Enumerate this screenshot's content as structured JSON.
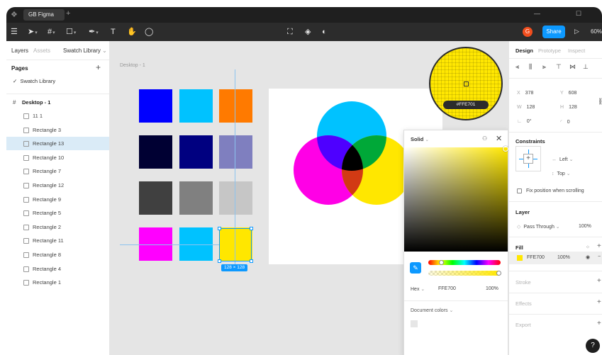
{
  "titlebar": {
    "tab": "GB Figma",
    "new_tab": "+",
    "minimize": "—",
    "maximize": "☐"
  },
  "toolbar": {
    "avatar": "G",
    "share": "Share",
    "zoom": "60%"
  },
  "left_panel": {
    "tabs": [
      "Layers",
      "Assets",
      "Swatch Library"
    ],
    "pages_heading": "Pages",
    "pages": [
      "Swatch Library"
    ],
    "frame": "Desktop - 1",
    "layers": [
      "11 1",
      "Rectangle 3",
      "Rectangle 13",
      "Rectangle 10",
      "Rectangle 7",
      "Rectangle 12",
      "Rectangle 9",
      "Rectangle 5",
      "Rectangle 2",
      "Rectangle 11",
      "Rectangle 8",
      "Rectangle 4",
      "Rectangle 1"
    ],
    "selected_layer": "Rectangle 13"
  },
  "canvas": {
    "frame_label": "Desktop - 1",
    "selection_size": "128 × 128",
    "swatches": [
      "#0000ff",
      "#00c2ff",
      "#ff7a00",
      "#000033",
      "#000080",
      "#7f7fbf",
      "#404040",
      "#808080",
      "#c6c6c6",
      "#ff00ff",
      "#00c2ff",
      "#ffe700"
    ],
    "magnifier_hex": "#FFE701"
  },
  "picker": {
    "mode": "Solid",
    "hex_label": "Hex",
    "hex_value": "FFE700",
    "opacity": "100%",
    "document_colors": "Document colors"
  },
  "right_panel": {
    "tabs": [
      "Design",
      "Prototype",
      "Inspect"
    ],
    "x": "378",
    "y": "608",
    "w": "128",
    "h": "128",
    "rotation": "0°",
    "radius": "0",
    "constraints": "Constraints",
    "constraint_h": "Left",
    "constraint_v": "Top",
    "fix_position": "Fix position when scrolling",
    "layer": "Layer",
    "blend": "Pass Through",
    "layer_opacity": "100%",
    "fill": "Fill",
    "fill_hex": "FFE700",
    "fill_opacity": "100%",
    "stroke": "Stroke",
    "effects": "Effects",
    "export": "Export"
  },
  "help": "?",
  "colors": {
    "accent": "#0d99ff",
    "fill": "#ffe700",
    "cyan": "#00c2ff",
    "magenta": "#ff00e6"
  }
}
